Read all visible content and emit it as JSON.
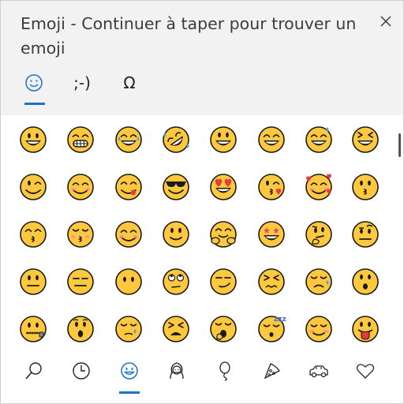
{
  "window": {
    "title": "Emoji - Continuer à taper pour trouver un emoji",
    "close_icon": "close-icon"
  },
  "top_tabs": [
    {
      "id": "emoji",
      "glyph": "☺",
      "icon": "smiley-outline-icon",
      "selected": true
    },
    {
      "id": "kaomoji",
      "glyph": ";-)",
      "icon": "kaomoji-icon",
      "selected": false
    },
    {
      "id": "symbols",
      "glyph": "Ω",
      "icon": "omega-icon",
      "selected": false
    }
  ],
  "emoji_grid": [
    [
      "grinning",
      "beaming",
      "tears-of-joy",
      "rolling-laughing",
      "smiley",
      "smile",
      "sweat-smile",
      "laughing"
    ],
    [
      "wink",
      "blush",
      "yum",
      "sunglasses",
      "heart-eyes",
      "kissing-heart",
      "smiling-hearts",
      "kissing"
    ],
    [
      "kissing-smiling-eyes",
      "kissing-closed-eyes",
      "relaxed",
      "slight-smile",
      "hugging",
      "star-struck",
      "thinking",
      "raised-eyebrow"
    ],
    [
      "neutral",
      "expressionless",
      "no-mouth",
      "eye-roll",
      "smirk",
      "persevering",
      "disappointed-relieved",
      "hushed"
    ],
    [
      "zipper-mouth",
      "open-mouth",
      "sleepy",
      "tired",
      "yawning",
      "sleeping",
      "relieved",
      "tongue-out"
    ]
  ],
  "bottom_tabs": [
    {
      "id": "search",
      "icon": "search-icon",
      "selected": false
    },
    {
      "id": "recent",
      "icon": "clock-icon",
      "selected": false
    },
    {
      "id": "smileys",
      "icon": "smiley-icon",
      "selected": true
    },
    {
      "id": "people",
      "icon": "person-icon",
      "selected": false
    },
    {
      "id": "celebrations",
      "icon": "balloon-icon",
      "selected": false
    },
    {
      "id": "food",
      "icon": "pizza-icon",
      "selected": false
    },
    {
      "id": "travel",
      "icon": "car-icon",
      "selected": false
    },
    {
      "id": "symbols",
      "icon": "heart-icon",
      "selected": false
    }
  ],
  "colors": {
    "accent": "#1a73c9",
    "emoji_face": "#FFC83D",
    "emoji_outline": "#1a1a1a",
    "header_bg": "#f2f2f2"
  }
}
